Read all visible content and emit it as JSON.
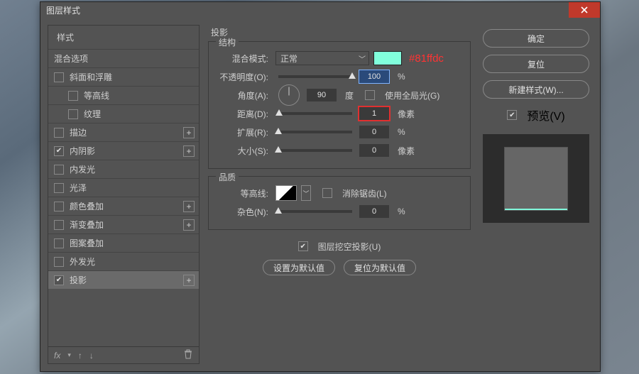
{
  "window": {
    "title": "图层样式"
  },
  "left": {
    "header": "样式",
    "rows": [
      {
        "label": "混合选项",
        "checked": null,
        "plus": false,
        "sub": false
      },
      {
        "label": "斜面和浮雕",
        "checked": false,
        "plus": false,
        "sub": false
      },
      {
        "label": "等高线",
        "checked": false,
        "plus": false,
        "sub": true
      },
      {
        "label": "纹理",
        "checked": false,
        "plus": false,
        "sub": true
      },
      {
        "label": "描边",
        "checked": false,
        "plus": true,
        "sub": false
      },
      {
        "label": "内阴影",
        "checked": true,
        "plus": true,
        "sub": false
      },
      {
        "label": "内发光",
        "checked": false,
        "plus": false,
        "sub": false
      },
      {
        "label": "光泽",
        "checked": false,
        "plus": false,
        "sub": false
      },
      {
        "label": "颜色叠加",
        "checked": false,
        "plus": true,
        "sub": false
      },
      {
        "label": "渐变叠加",
        "checked": false,
        "plus": true,
        "sub": false
      },
      {
        "label": "图案叠加",
        "checked": false,
        "plus": false,
        "sub": false
      },
      {
        "label": "外发光",
        "checked": false,
        "plus": false,
        "sub": false
      },
      {
        "label": "投影",
        "checked": true,
        "plus": true,
        "sub": false,
        "selected": true
      }
    ],
    "footer_fx": "fx"
  },
  "middle": {
    "title": "投影",
    "structure": {
      "group_label": "结构",
      "blend_label": "混合模式:",
      "blend_value": "正常",
      "swatch_color": "#81ffdc",
      "hex_annotation": "#81ffdc",
      "opacity_label": "不透明度(O):",
      "opacity_value": "100",
      "opacity_unit": "%",
      "angle_label": "角度(A):",
      "angle_value": "90",
      "angle_unit": "度",
      "global_light_label": "使用全局光(G)",
      "global_light_checked": false,
      "distance_label": "距离(D):",
      "distance_value": "1",
      "distance_unit": "像素",
      "spread_label": "扩展(R):",
      "spread_value": "0",
      "spread_unit": "%",
      "size_label": "大小(S):",
      "size_value": "0",
      "size_unit": "像素"
    },
    "quality": {
      "group_label": "品质",
      "contour_label": "等高线:",
      "antialias_label": "消除锯齿(L)",
      "antialias_checked": false,
      "noise_label": "杂色(N):",
      "noise_value": "0",
      "noise_unit": "%"
    },
    "knockout": {
      "label": "图层挖空投影(U)",
      "checked": true
    },
    "buttons": {
      "default": "设置为默认值",
      "reset": "复位为默认值"
    }
  },
  "right": {
    "ok": "确定",
    "cancel": "复位",
    "new_style": "新建样式(W)...",
    "preview_label": "预览(V)",
    "preview_checked": true
  }
}
